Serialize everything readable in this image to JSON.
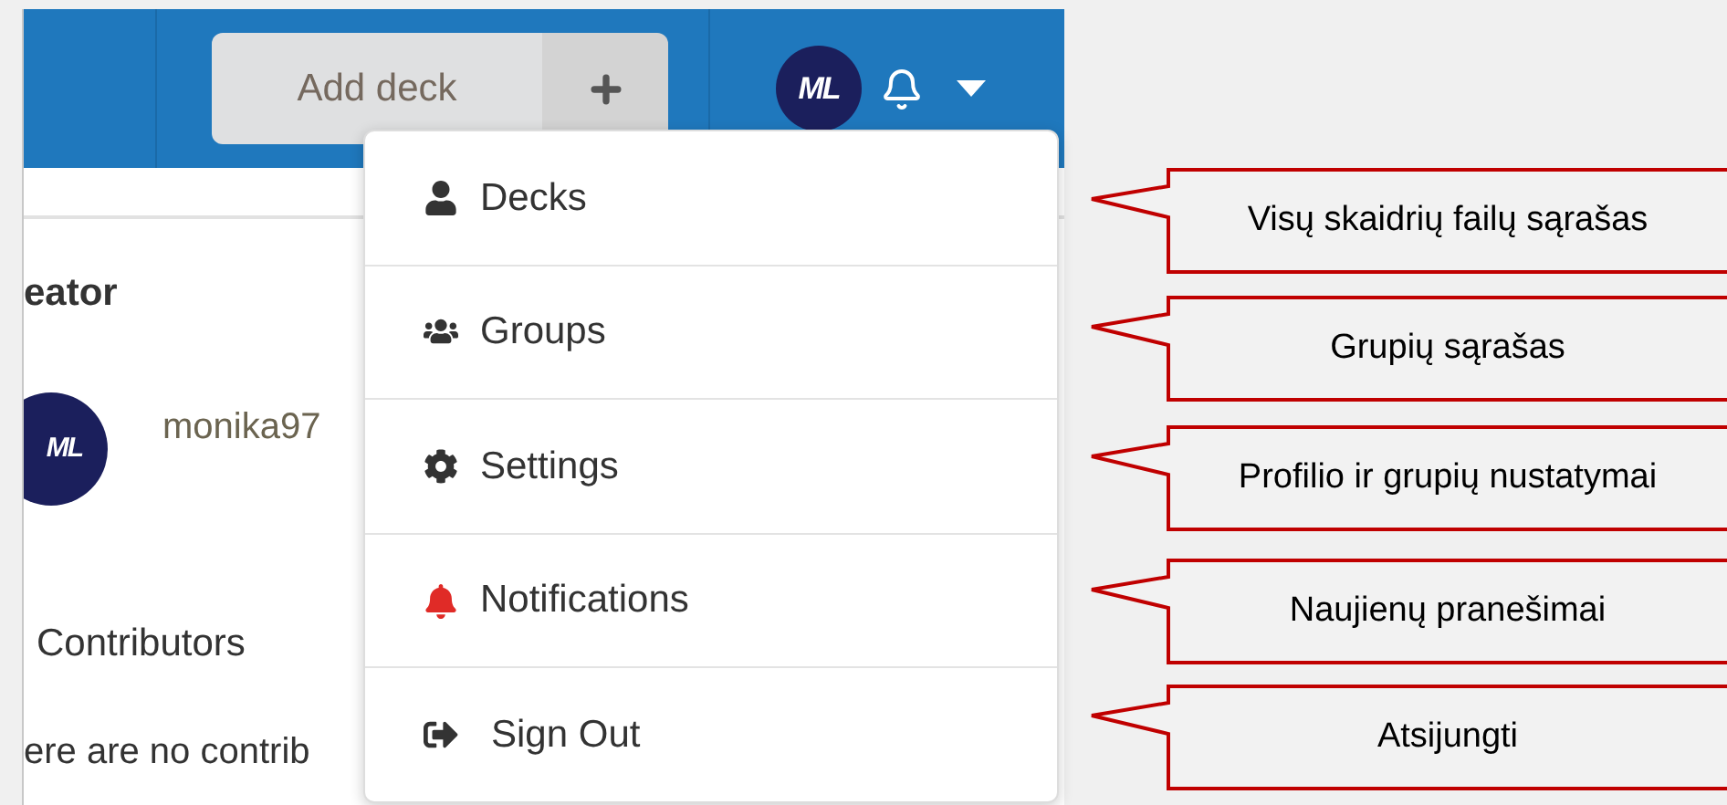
{
  "header": {
    "add_button": "Add deck",
    "avatar_initials": "ML"
  },
  "content": {
    "heading": "eator",
    "user_initials": "ML",
    "username": "monika97",
    "section_title": "Contributors",
    "empty_message": "ere are no contrib"
  },
  "menu": [
    {
      "label": "Decks"
    },
    {
      "label": "Groups"
    },
    {
      "label": "Settings"
    },
    {
      "label": "Notifications"
    },
    {
      "label": "Sign Out"
    }
  ],
  "callouts": [
    "Visų skaidrių failų sąrašas",
    "Grupių sąrašas",
    "Profilio ir grupių nustatymai",
    "Naujienų pranešimai",
    "Atsijungti"
  ]
}
